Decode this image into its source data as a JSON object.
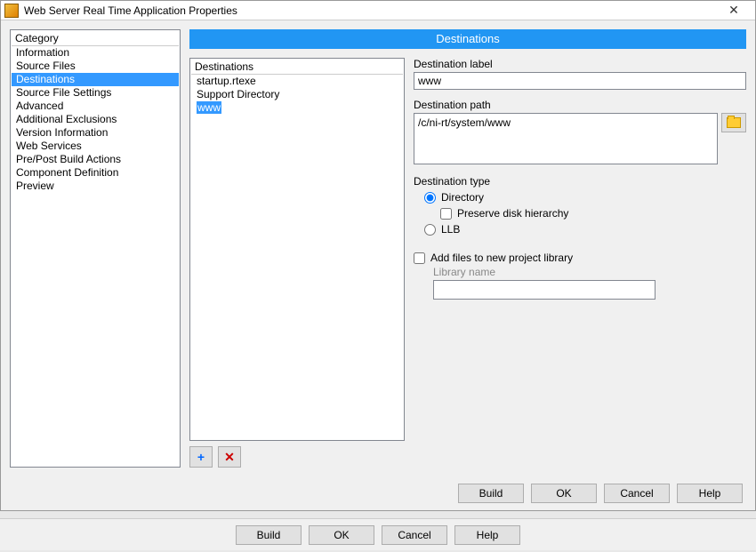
{
  "window": {
    "title": "Web Server Real Time Application Properties"
  },
  "category": {
    "header": "Category",
    "items": [
      "Information",
      "Source Files",
      "Destinations",
      "Source File Settings",
      "Advanced",
      "Additional Exclusions",
      "Version Information",
      "Web Services",
      "Pre/Post Build Actions",
      "Component Definition",
      "Preview"
    ],
    "selected_index": 2
  },
  "page_title": "Destinations",
  "dest_list": {
    "header": "Destinations",
    "items": [
      "startup.rtexe",
      "Support Directory",
      "www"
    ],
    "selected_index": 2
  },
  "icons": {
    "add": "+",
    "remove": "✕"
  },
  "form": {
    "dest_label_label": "Destination label",
    "dest_label_value": "www",
    "dest_path_label": "Destination path",
    "dest_path_value": "/c/ni-rt/system/www",
    "dest_type_label": "Destination type",
    "radio_directory": "Directory",
    "preserve_hierarchy": "Preserve disk hierarchy",
    "radio_llb": "LLB",
    "add_files_label": "Add files to new project library",
    "library_name_label": "Library name",
    "library_name_value": ""
  },
  "footer": {
    "build": "Build",
    "ok": "OK",
    "cancel": "Cancel",
    "help": "Help"
  }
}
